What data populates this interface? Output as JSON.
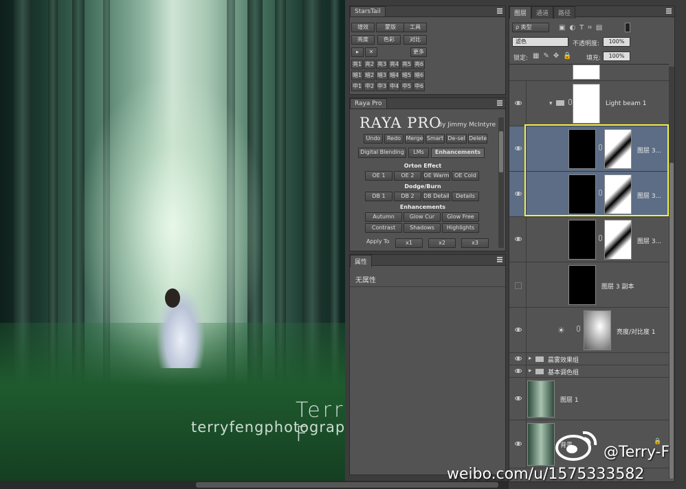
{
  "photo": {
    "watermark_name": "Terry F",
    "watermark_url": "terryfengphotography.lofter.com"
  },
  "starstail": {
    "tab": "StarsTail",
    "row1": [
      "增效",
      "蒙版",
      "工具"
    ],
    "row2": [
      "亮度",
      "色彩",
      "对比"
    ],
    "row3": [
      "▸",
      "✕",
      "更多"
    ],
    "grid": [
      [
        "亮1",
        "亮2",
        "亮3",
        "亮4",
        "亮5",
        "亮6"
      ],
      [
        "暗1",
        "暗2",
        "暗3",
        "暗4",
        "暗5",
        "暗6"
      ],
      [
        "中1",
        "中2",
        "中3",
        "中4",
        "中5",
        "中6"
      ]
    ]
  },
  "raya": {
    "tab": "Raya Pro",
    "title": "RAYA PRO",
    "byline": "By Jimmy McIntyre",
    "actions": [
      "Undo",
      "Redo",
      "Merge",
      "Smart",
      "De-sel",
      "Delete"
    ],
    "tabs": [
      "Digital Blending",
      "LMs",
      "Enhancements"
    ],
    "orton_label": "Orton Effect",
    "orton": [
      "OE 1",
      "OE 2",
      "OE Warm",
      "OE Cold"
    ],
    "dodge_label": "Dodge/Burn",
    "dodge": [
      "DB 1",
      "DB 2",
      "DB Details",
      "Details"
    ],
    "enh_label": "Enhancements",
    "enh_row1": [
      "Autumn",
      "Glow Cur",
      "Glow Free"
    ],
    "enh_row2": [
      "Contrast",
      "Shadows",
      "Highlights"
    ],
    "apply_label": "Apply To",
    "apply": [
      "x1",
      "x2",
      "x3"
    ]
  },
  "properties": {
    "tab": "属性",
    "empty": "无属性"
  },
  "layers": {
    "tabs": [
      "图层",
      "通道",
      "路径"
    ],
    "filter_type": "ρ 类型",
    "blend_mode": "滤色",
    "opacity_label": "不透明度:",
    "opacity_value": "100%",
    "lock_label": "锁定:",
    "fill_label": "填充:",
    "fill_value": "100%",
    "rows": [
      {
        "name": "Light beam 1"
      },
      {
        "name": "图层 3..."
      },
      {
        "name": "图层 3..."
      },
      {
        "name": "图层 3..."
      },
      {
        "name": "图层 3 副本"
      },
      {
        "name": "亮度/对比度 1"
      },
      {
        "name": "晨雾效果组"
      },
      {
        "name": "基本调色组"
      },
      {
        "name": "图层 1"
      },
      {
        "name": "背景"
      }
    ]
  },
  "overlay": {
    "weibo_handle": "@Terry-F",
    "weibo_url": "weibo.com/u/1575333582"
  }
}
